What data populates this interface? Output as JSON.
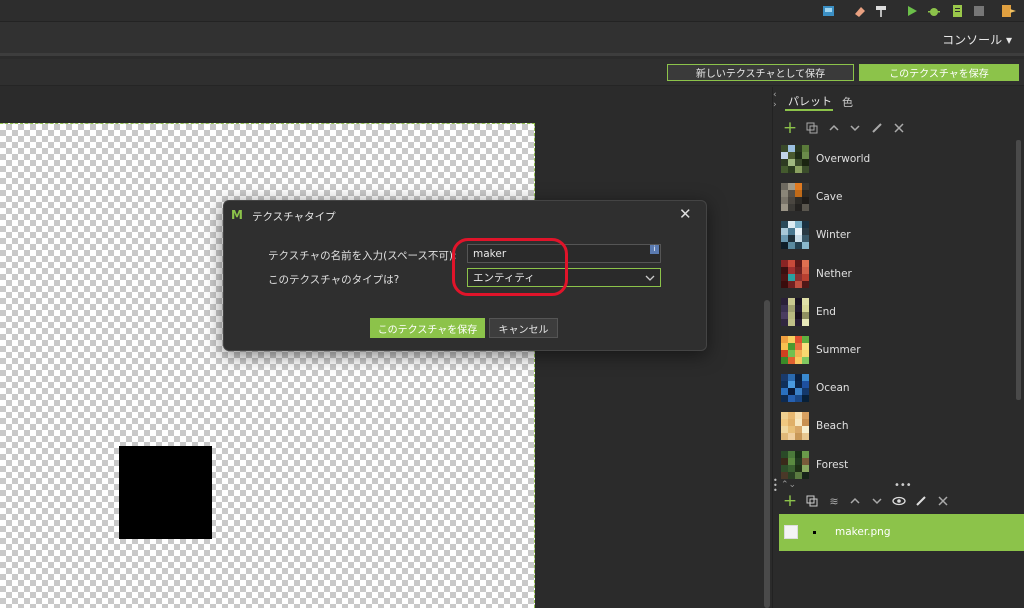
{
  "toolbar": {
    "icons": [
      "export-icon",
      "eraser-icon",
      "hammer-icon",
      "run-icon",
      "debug-icon",
      "clipboard-icon",
      "stop-icon",
      "exit-icon"
    ]
  },
  "header": {
    "console_label": "コンソール ▾"
  },
  "actions": {
    "save_as_new": "新しいテクスチャとして保存",
    "save_this": "このテクスチャを保存"
  },
  "right_panel": {
    "tabs": [
      "パレット",
      "色"
    ],
    "palettes": [
      {
        "name": "Overworld",
        "colors": [
          "#3a4a2a",
          "#9bbfe0",
          "#2a3820",
          "#5a7a3a",
          "#c2d4e8",
          "#4a5a30",
          "#1e2a16",
          "#6a8a4a",
          "#2e3b22",
          "#a0b880",
          "#3a4a2a",
          "#1a2410",
          "#445a2e",
          "#2b3b1f",
          "#8aa060",
          "#3b4d2b"
        ]
      },
      {
        "name": "Cave",
        "colors": [
          "#6e6a60",
          "#a09a8a",
          "#e07a20",
          "#3a3834",
          "#8a8578",
          "#555048",
          "#c06a18",
          "#2a2824",
          "#7a756a",
          "#4a4640",
          "#2e2c28",
          "#1e1c1a",
          "#9a9486",
          "#3c3a36",
          "#242220",
          "#5a564e"
        ]
      },
      {
        "name": "Winter",
        "colors": [
          "#2a4a5a",
          "#dcebf2",
          "#7ab0c8",
          "#1a3040",
          "#a8c8d8",
          "#4a7890",
          "#e8f2f8",
          "#2a3a44",
          "#6a98b0",
          "#1e2e38",
          "#c8dce8",
          "#3a5868",
          "#0f1e28",
          "#5a8aa0",
          "#244050",
          "#8ab8cc"
        ]
      },
      {
        "name": "Nether",
        "colors": [
          "#8a2424",
          "#c84a3a",
          "#5a1818",
          "#e07050",
          "#3a1010",
          "#a03030",
          "#6a2020",
          "#d06048",
          "#4a1414",
          "#2aa0a0",
          "#8a3030",
          "#b84030",
          "#3a0c0c",
          "#702020",
          "#c05040",
          "#501818"
        ]
      },
      {
        "name": "End",
        "colors": [
          "#2a2038",
          "#c8c890",
          "#1a1424",
          "#e0e0a8",
          "#3a3050",
          "#a0a070",
          "#221a30",
          "#d8d898",
          "#4a3c60",
          "#b8b880",
          "#1a1020",
          "#909060",
          "#302640",
          "#c0c088",
          "#281e34",
          "#e8e8b8"
        ]
      },
      {
        "name": "Summer",
        "colors": [
          "#f0a040",
          "#f8d060",
          "#e05030",
          "#60b040",
          "#f8c050",
          "#4a9a30",
          "#e87040",
          "#f8e080",
          "#d04020",
          "#70c050",
          "#f0b050",
          "#f8d870",
          "#3a8a28",
          "#e06030",
          "#f8c860",
          "#80c860"
        ]
      },
      {
        "name": "Ocean",
        "colors": [
          "#1a3a6a",
          "#2a6ab0",
          "#0a2040",
          "#3a8ad0",
          "#10305a",
          "#4a9ae0",
          "#0c2448",
          "#1e50a0",
          "#2a70c0",
          "#0a1a38",
          "#3a80c8",
          "#14386a",
          "#0e2a50",
          "#2660b0",
          "#1a4888",
          "#082038"
        ]
      },
      {
        "name": "Beach",
        "colors": [
          "#f0d090",
          "#e8b870",
          "#f8e0b0",
          "#d8a060",
          "#f0c880",
          "#e0b068",
          "#f8e8c0",
          "#c89050",
          "#f0d8a0",
          "#e8c078",
          "#d8a868",
          "#f8f0d0",
          "#e0b878",
          "#f0d0a0",
          "#c89858",
          "#e8c890"
        ]
      },
      {
        "name": "Forest",
        "colors": [
          "#2a4a28",
          "#4a7a3a",
          "#1a3018",
          "#6a9a4a",
          "#3a2a1a",
          "#5a8a40",
          "#223a20",
          "#7a5a3a",
          "#2e4e2a",
          "#3a6030",
          "#1e2e16",
          "#8aa860",
          "#4a3828",
          "#2a4024",
          "#5a7a40",
          "#16241a"
        ]
      }
    ],
    "layer": {
      "filename": "maker.png"
    }
  },
  "dialog": {
    "title": "テクスチャタイプ",
    "name_label": "テクスチャの名前を入力(スペース不可):",
    "name_value": "maker",
    "type_label": "このテクスチャのタイプは?",
    "type_value": "エンティティ",
    "save_button": "このテクスチャを保存",
    "cancel_button": "キャンセル"
  },
  "colors": {
    "accent_green": "#8cc34a",
    "highlight_red": "#e0142a"
  }
}
